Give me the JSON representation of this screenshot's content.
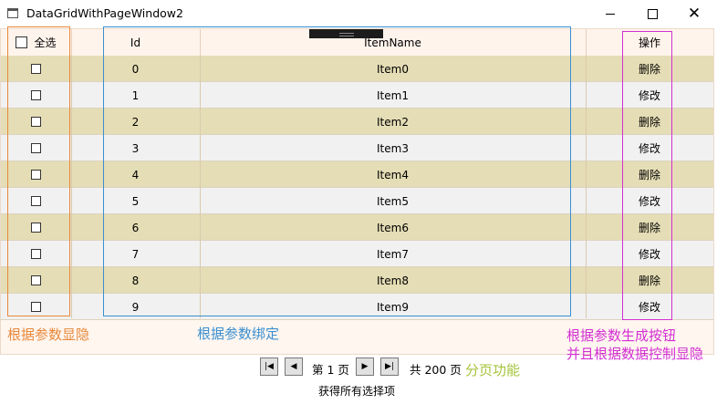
{
  "window": {
    "title": "DataGridWithPageWindow2",
    "minimize_glyph": "—",
    "maximize_glyph": "☐",
    "close_glyph": "✕"
  },
  "grid": {
    "headers": {
      "select_all": "全选",
      "id": "Id",
      "item_name": "ItemName",
      "action": "操作"
    },
    "rows": [
      {
        "id": "0",
        "name": "Item0",
        "action": "删除"
      },
      {
        "id": "1",
        "name": "Item1",
        "action": "修改"
      },
      {
        "id": "2",
        "name": "Item2",
        "action": "删除"
      },
      {
        "id": "3",
        "name": "Item3",
        "action": "修改"
      },
      {
        "id": "4",
        "name": "Item4",
        "action": "删除"
      },
      {
        "id": "5",
        "name": "Item5",
        "action": "修改"
      },
      {
        "id": "6",
        "name": "Item6",
        "action": "删除"
      },
      {
        "id": "7",
        "name": "Item7",
        "action": "修改"
      },
      {
        "id": "8",
        "name": "Item8",
        "action": "删除"
      },
      {
        "id": "9",
        "name": "Item9",
        "action": "修改"
      }
    ]
  },
  "annotations": {
    "visibility": "根据参数显隐",
    "binding": "根据参数绑定",
    "buttons_line1": "根据参数生成按钮",
    "buttons_line2": "并且根据数据控制显隐",
    "paging": "分页功能",
    "colors": {
      "orange": "#e8883a",
      "blue": "#3a8fd0",
      "magenta": "#d22fd2",
      "green": "#a6c43a"
    }
  },
  "pager": {
    "first_icon": "first-page-icon",
    "prev_icon": "prev-page-icon",
    "next_icon": "next-page-icon",
    "last_icon": "last-page-icon",
    "current_page": "第 1 页",
    "total_pages": "共 200 页"
  },
  "get_selected_label": "获得所有选择项"
}
